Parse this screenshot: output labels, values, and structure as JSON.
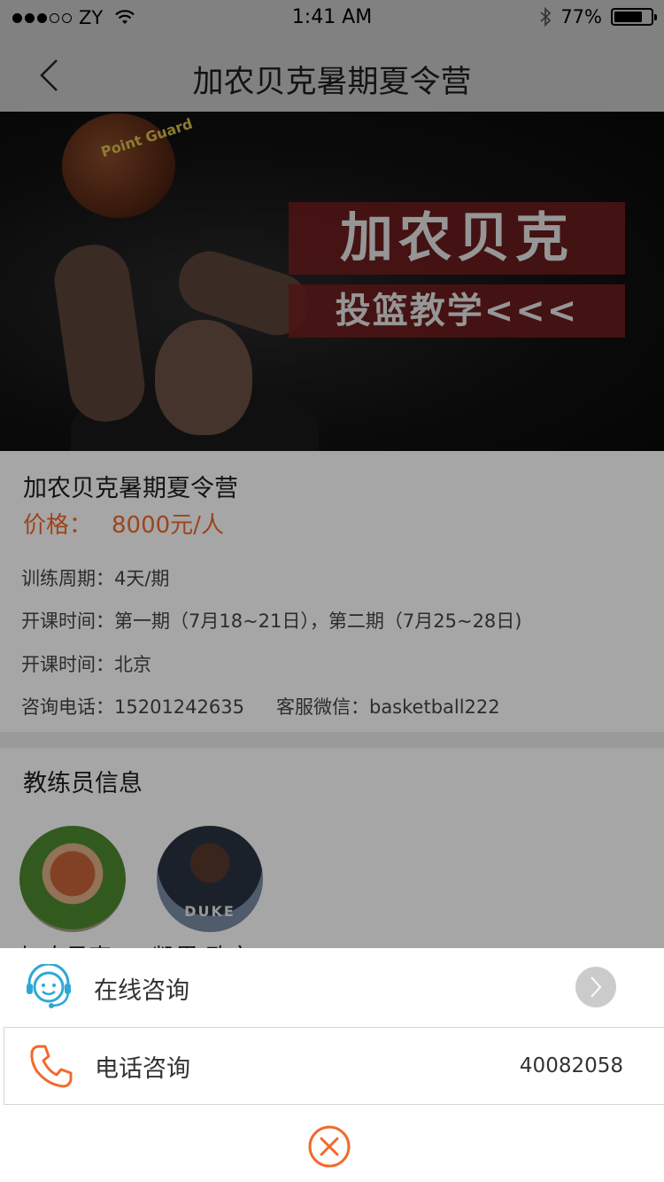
{
  "status_bar": {
    "carrier": "ZY",
    "time": "1:41 AM",
    "battery": "77%",
    "battery_level": 0.77,
    "icons": [
      "signal-dots-icon",
      "wifi-icon",
      "bluetooth-icon",
      "battery-icon"
    ]
  },
  "nav": {
    "back_icon": "chevron-left-icon",
    "title": "加农贝克暑期夏令营"
  },
  "banner": {
    "ball_text": "Point Guard",
    "headline": "加农贝克",
    "subline": "投篮教学<<<"
  },
  "product": {
    "title": "加农贝克暑期夏令营",
    "price_label": "价格：",
    "price_value": "8000元/人",
    "period": "训练周期：4天/期",
    "schedule": "开课时间：第一期（7月18~21日），第二期（7月25~28日)",
    "location": "开课时间：北京",
    "phone": "咨询电话：15201242635",
    "wechat": "客服微信：basketball222"
  },
  "coaches": {
    "title": "教练员信息",
    "list": [
      {
        "name": "加农贝克",
        "avatar_tag": ""
      },
      {
        "name": "凯里·欧文",
        "avatar_tag": "DUKE"
      }
    ]
  },
  "sheet": {
    "online_label": "在线咨询",
    "phone_label": "电话咨询",
    "phone_number": "40082058",
    "icons": {
      "online": "headset-icon",
      "phone": "phone-icon",
      "arrow": "chevron-right-icon",
      "close": "close-circle-icon"
    },
    "colors": {
      "online_icon": "#2fa7d6",
      "phone_icon": "#f26a2a",
      "close_icon": "#f26a2a",
      "price": "#f26a2a"
    }
  }
}
